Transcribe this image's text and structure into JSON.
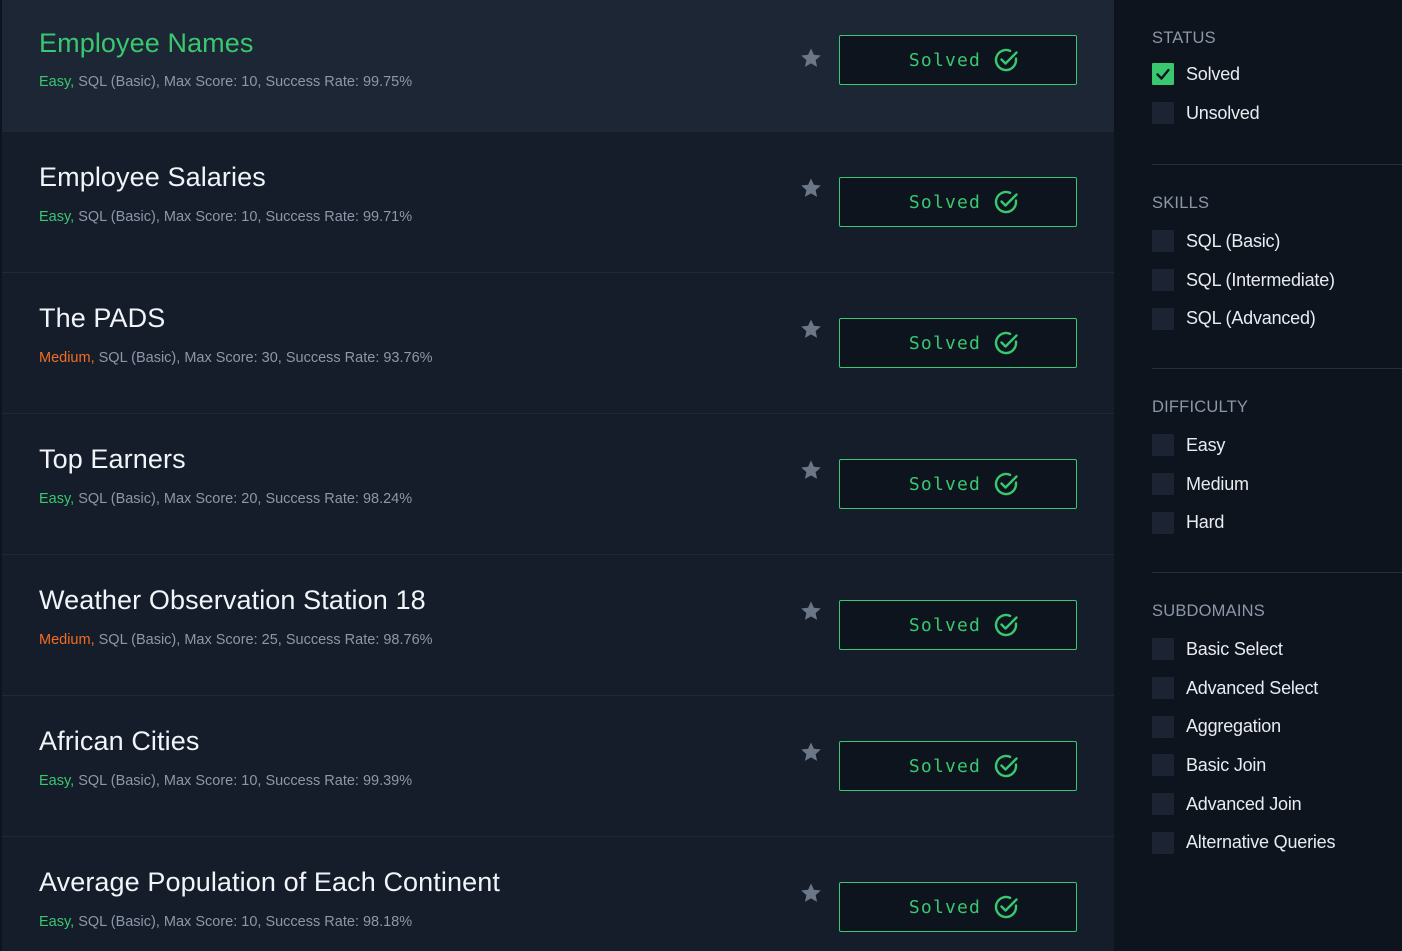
{
  "challenges": [
    {
      "title": "Employee Names",
      "difficulty": "Easy,",
      "difficulty_level": "easy",
      "details": " SQL (Basic), Max Score: 10, Success Rate: 99.75%",
      "status": "Solved"
    },
    {
      "title": "Employee Salaries",
      "difficulty": "Easy,",
      "difficulty_level": "easy",
      "details": " SQL (Basic), Max Score: 10, Success Rate: 99.71%",
      "status": "Solved"
    },
    {
      "title": "The PADS",
      "difficulty": "Medium,",
      "difficulty_level": "medium",
      "details": " SQL (Basic), Max Score: 30, Success Rate: 93.76%",
      "status": "Solved"
    },
    {
      "title": "Top Earners",
      "difficulty": "Easy,",
      "difficulty_level": "easy",
      "details": " SQL (Basic), Max Score: 20, Success Rate: 98.24%",
      "status": "Solved"
    },
    {
      "title": "Weather Observation Station 18",
      "difficulty": "Medium,",
      "difficulty_level": "medium",
      "details": " SQL (Basic), Max Score: 25, Success Rate: 98.76%",
      "status": "Solved"
    },
    {
      "title": "African Cities",
      "difficulty": "Easy,",
      "difficulty_level": "easy",
      "details": " SQL (Basic), Max Score: 10, Success Rate: 99.39%",
      "status": "Solved"
    },
    {
      "title": "Average Population of Each Continent",
      "difficulty": "Easy,",
      "difficulty_level": "easy",
      "details": " SQL (Basic), Max Score: 10, Success Rate: 98.18%",
      "status": "Solved"
    }
  ],
  "filters": {
    "status": {
      "heading": "STATUS",
      "options": [
        {
          "label": "Solved",
          "checked": true
        },
        {
          "label": "Unsolved",
          "checked": false
        }
      ]
    },
    "skills": {
      "heading": "SKILLS",
      "options": [
        {
          "label": "SQL (Basic)",
          "checked": false
        },
        {
          "label": "SQL (Intermediate)",
          "checked": false
        },
        {
          "label": "SQL (Advanced)",
          "checked": false
        }
      ]
    },
    "difficulty": {
      "heading": "DIFFICULTY",
      "options": [
        {
          "label": "Easy",
          "checked": false
        },
        {
          "label": "Medium",
          "checked": false
        },
        {
          "label": "Hard",
          "checked": false
        }
      ]
    },
    "subdomains": {
      "heading": "SUBDOMAINS",
      "options": [
        {
          "label": "Basic Select",
          "checked": false
        },
        {
          "label": "Advanced Select",
          "checked": false
        },
        {
          "label": "Aggregation",
          "checked": false
        },
        {
          "label": "Basic Join",
          "checked": false
        },
        {
          "label": "Advanced Join",
          "checked": false
        },
        {
          "label": "Alternative Queries",
          "checked": false
        }
      ]
    }
  },
  "icons": {
    "star": "star-icon",
    "solved": "check-circle-icon",
    "checkbox_check": "checkmark-icon"
  },
  "colors": {
    "accent_green": "#39c76f",
    "medium_orange": "#f26d22",
    "page_bg": "#0e141e",
    "list_bg": "#151d2a"
  }
}
